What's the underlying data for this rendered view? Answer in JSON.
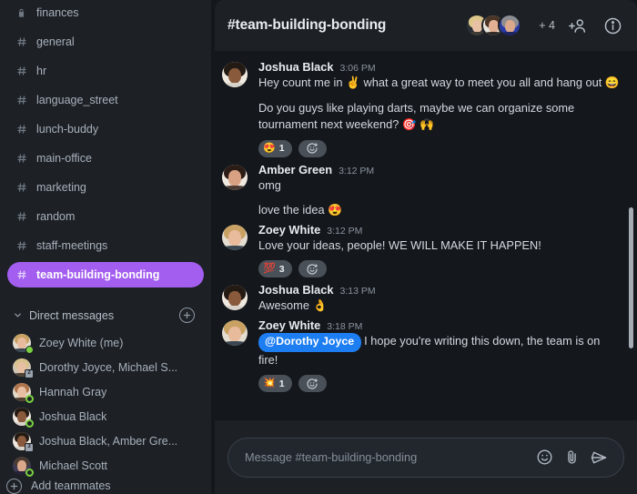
{
  "sidebar": {
    "channels": [
      {
        "label": "finances",
        "icon": "lock-icon",
        "active": false
      },
      {
        "label": "general",
        "icon": "hash-icon",
        "active": false
      },
      {
        "label": "hr",
        "icon": "hash-icon",
        "active": false
      },
      {
        "label": "language_street",
        "icon": "hash-icon",
        "active": false
      },
      {
        "label": "lunch-buddy",
        "icon": "hash-icon",
        "active": false
      },
      {
        "label": "main-office",
        "icon": "hash-icon",
        "active": false
      },
      {
        "label": "marketing",
        "icon": "hash-icon",
        "active": false
      },
      {
        "label": "random",
        "icon": "hash-icon",
        "active": false
      },
      {
        "label": "staff-meetings",
        "icon": "hash-icon",
        "active": false
      },
      {
        "label": "team-building-bonding",
        "icon": "hash-icon",
        "active": true
      }
    ],
    "dm_section": {
      "title": "Direct messages",
      "add_icon": "plus-circle-icon",
      "chevron_icon": "chevron-down-icon"
    },
    "dms": [
      {
        "name": "Zoey White (me)",
        "status": "online",
        "badge_text": ""
      },
      {
        "name": "Dorothy Joyce, Michael S...",
        "status": "count",
        "badge_text": "2"
      },
      {
        "name": "Hannah Gray",
        "status": "away",
        "badge_text": ""
      },
      {
        "name": "Joshua Black",
        "status": "away",
        "badge_text": ""
      },
      {
        "name": "Joshua Black, Amber Gre...",
        "status": "count",
        "badge_text": "3"
      },
      {
        "name": "Michael Scott",
        "status": "away",
        "badge_text": ""
      }
    ],
    "add_teammates": {
      "label": "Add teammates",
      "icon": "plus-circle-icon"
    }
  },
  "header": {
    "title": "#team-building-bonding",
    "members_more": "+ 4",
    "add_member_icon": "person-plus-icon",
    "info_icon": "info-circle-icon"
  },
  "messages": [
    {
      "author": "Joshua Black",
      "time": "3:06 PM",
      "avatar": "joshua",
      "lines": [
        "Hey count me in ✌️ what a great way to meet you all and hang out 😄",
        "Do you guys like playing darts, maybe we can organize some tournament next weekend? 🎯 🙌"
      ],
      "mention": "",
      "reactions": [
        {
          "emoji": "😍",
          "count": "1"
        }
      ],
      "add_reaction_icon": "add-reaction-icon"
    },
    {
      "author": "Amber Green",
      "time": "3:12 PM",
      "avatar": "amber",
      "lines": [
        "omg",
        "love the idea 😍"
      ],
      "mention": "",
      "reactions": [],
      "add_reaction_icon": "add-reaction-icon"
    },
    {
      "author": "Zoey White",
      "time": "3:12 PM",
      "avatar": "zoey",
      "lines": [
        "Love your ideas, people! WE WILL MAKE IT HAPPEN!"
      ],
      "mention": "",
      "reactions": [
        {
          "emoji": "💯",
          "count": "3"
        }
      ],
      "add_reaction_icon": "add-reaction-icon"
    },
    {
      "author": "Joshua Black",
      "time": "3:13 PM",
      "avatar": "joshua",
      "lines": [
        "Awesome 👌"
      ],
      "mention": "",
      "reactions": [],
      "add_reaction_icon": "add-reaction-icon"
    },
    {
      "author": "Zoey White",
      "time": "3:18 PM",
      "avatar": "zoey",
      "lines": [
        "I hope you're writing this down, the team is on fire!"
      ],
      "mention": "@Dorothy Joyce",
      "reactions": [
        {
          "emoji": "💥",
          "count": "1"
        }
      ],
      "add_reaction_icon": "add-reaction-icon"
    }
  ],
  "composer": {
    "placeholder": "Message #team-building-bonding",
    "value": "",
    "emoji_icon": "emoji-smiley-icon",
    "attach_icon": "paperclip-icon",
    "send_icon": "send-plane-icon"
  },
  "colors": {
    "accent": "#a35ef0",
    "mention": "#1d7ef2",
    "online": "#7ad13f",
    "sidebar_bg": "#1d2126",
    "chat_bg": "#14171c"
  }
}
